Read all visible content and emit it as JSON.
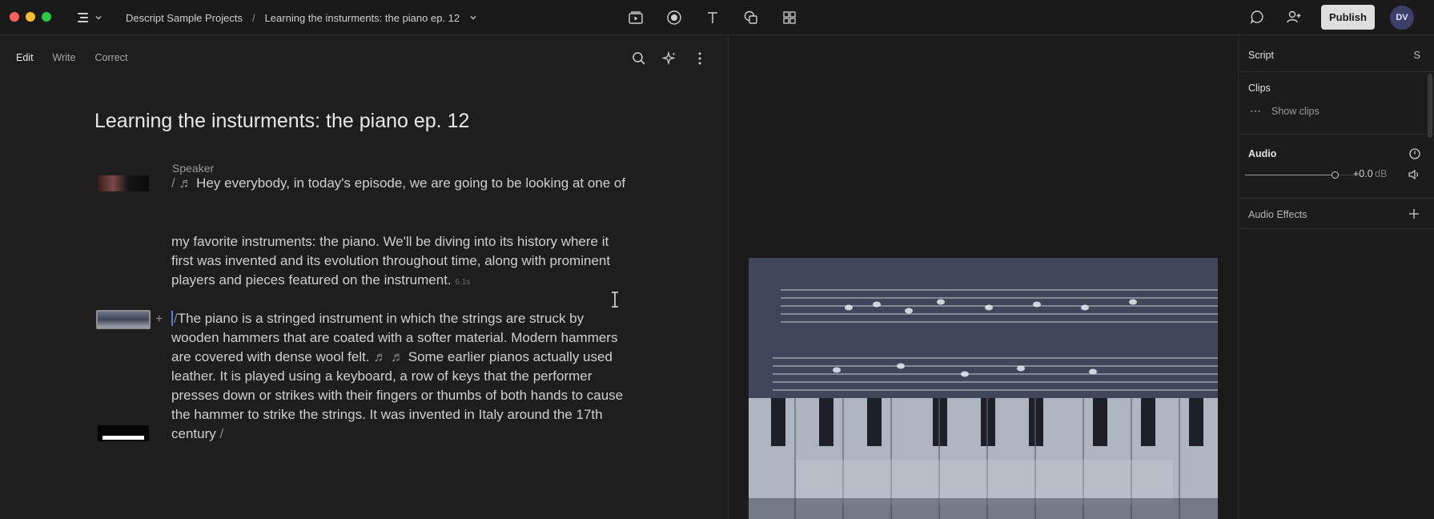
{
  "window": {
    "breadcrumb": [
      "Descript Sample Projects",
      "Learning the insturments: the piano ep. 12"
    ],
    "breadcrumb_separator": "/",
    "publish_label": "Publish",
    "avatar_initials": "DV"
  },
  "editor": {
    "tabs": [
      "Edit",
      "Write",
      "Correct"
    ],
    "active_tab": "Edit",
    "title": "Learning the insturments: the piano ep. 12",
    "speaker": "Speaker",
    "paragraphs": {
      "p1_prefix": "/  ♬  ",
      "p1_text": "Hey everybody, in today's episode, we are going to be looking at one of",
      "p2_text": "my favorite instruments: the piano. We'll be diving into its history where it first was invented and its evolution throughout time, along with prominent players and pieces featured on the instrument.",
      "p2_pause": "6.1s",
      "p3_prefix": "/",
      "p3_text_a": "The piano is a stringed instrument in which the strings are struck by wooden hammers that are coated with a softer material. Modern hammers are covered with dense wool felt.",
      "p3_notes": "  ♬   ♬ ",
      "p3_text_b": "Some earlier pianos actually used leather. It is played using a keyboard, a row of keys that the performer presses down or strikes with their fingers or thumbs of both hands to cause the hammer to strike the strings. It was invented in Italy around the 17th century",
      "p3_suffix": " /"
    }
  },
  "panel": {
    "script_label": "Script",
    "script_shortcut": "S",
    "clips_label": "Clips",
    "show_clips_label": "Show clips",
    "audio_label": "Audio",
    "audio_volume_db": "+0.0",
    "audio_unit": "dB",
    "audio_slider_level": 0.78,
    "audio_effects_label": "Audio Effects"
  },
  "colors": {
    "background": "#1e1e1e",
    "panel": "#1c1c1c",
    "publish_button": "#dedede",
    "avatar": "#3b3f69"
  }
}
